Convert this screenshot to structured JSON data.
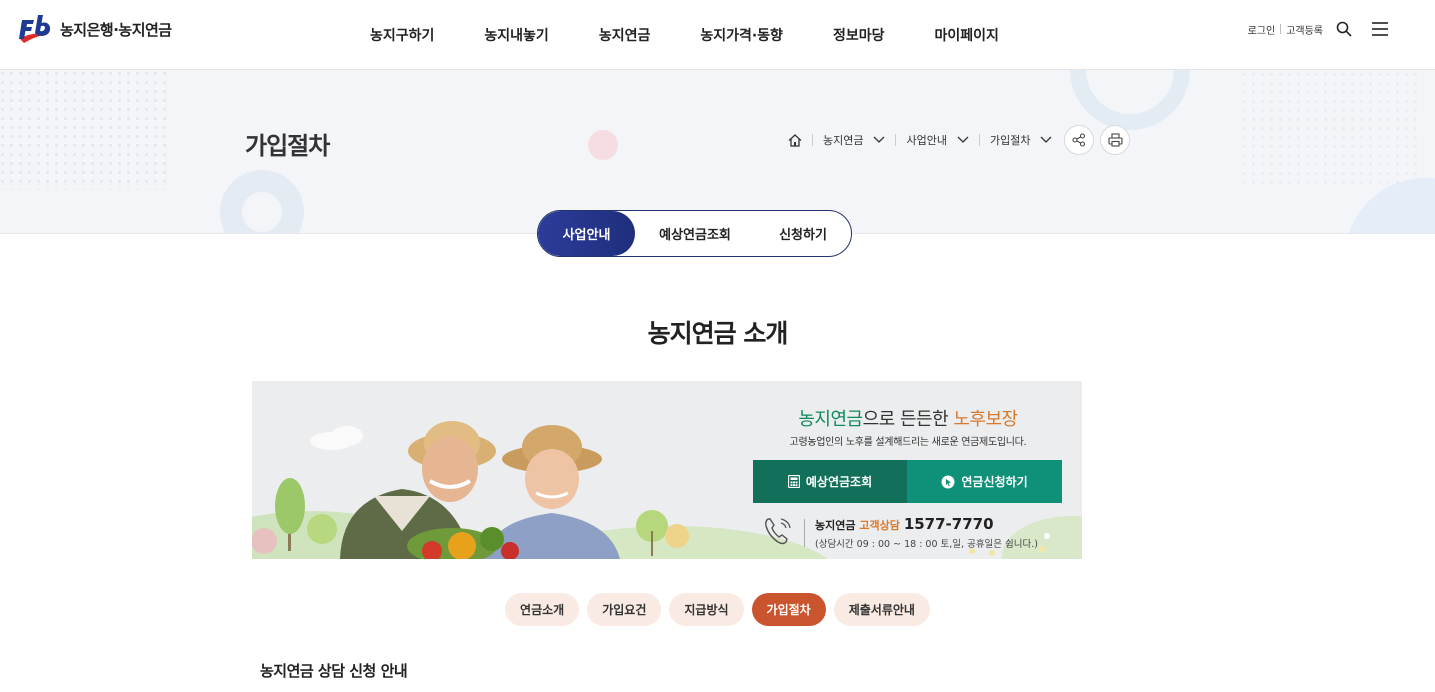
{
  "brand": {
    "logo_letters": "Fb",
    "name": "농지은행·농지연금",
    "colors": {
      "blue": "#1f3a93",
      "red": "#e02a2a",
      "green": "#0f8a5f",
      "orange": "#d9792b",
      "accent": "#c9542d",
      "navy": "#23356f"
    }
  },
  "gnb": {
    "items": [
      "농지구하기",
      "농지내놓기",
      "농지연금",
      "농지가격·동향",
      "정보마당",
      "마이페이지"
    ]
  },
  "util": {
    "login": "로그인",
    "register": "고객등록",
    "search_icon": "search-icon",
    "menu_icon": "hamburger-icon"
  },
  "hero": {
    "title": "가입절차",
    "breadcrumb": [
      "농지연금",
      "사업안내",
      "가입절차"
    ],
    "home_icon": "home-icon",
    "share_icon": "share-icon",
    "print_icon": "print-icon"
  },
  "segment_tabs": [
    {
      "label": "사업안내",
      "active": true
    },
    {
      "label": "예상연금조회",
      "active": false
    },
    {
      "label": "신청하기",
      "active": false
    }
  ],
  "main": {
    "section_title": "농지연금 소개"
  },
  "banner": {
    "title_part1": "농지연금",
    "title_part2": "으로 든든한 ",
    "title_part3": "노후보장",
    "subtitle": "고령농업인의 노후를 설계해드리는 새로운 연금제도입니다.",
    "btn_estimate": "예상연금조회",
    "btn_apply": "연금신청하기",
    "call_brand": "농지연금",
    "call_label": "고객상담",
    "call_number": "1577-7770",
    "call_hours": "(상담시간 09 : 00 ~ 18 : 00 토,일, 공휴일은 쉽니다.)"
  },
  "pill_tabs": [
    {
      "label": "연금소개",
      "active": false
    },
    {
      "label": "가입요건",
      "active": false
    },
    {
      "label": "지급방식",
      "active": false
    },
    {
      "label": "가입절차",
      "active": true
    },
    {
      "label": "제출서류안내",
      "active": false
    }
  ],
  "subheading": "농지연금 상담 신청 안내"
}
